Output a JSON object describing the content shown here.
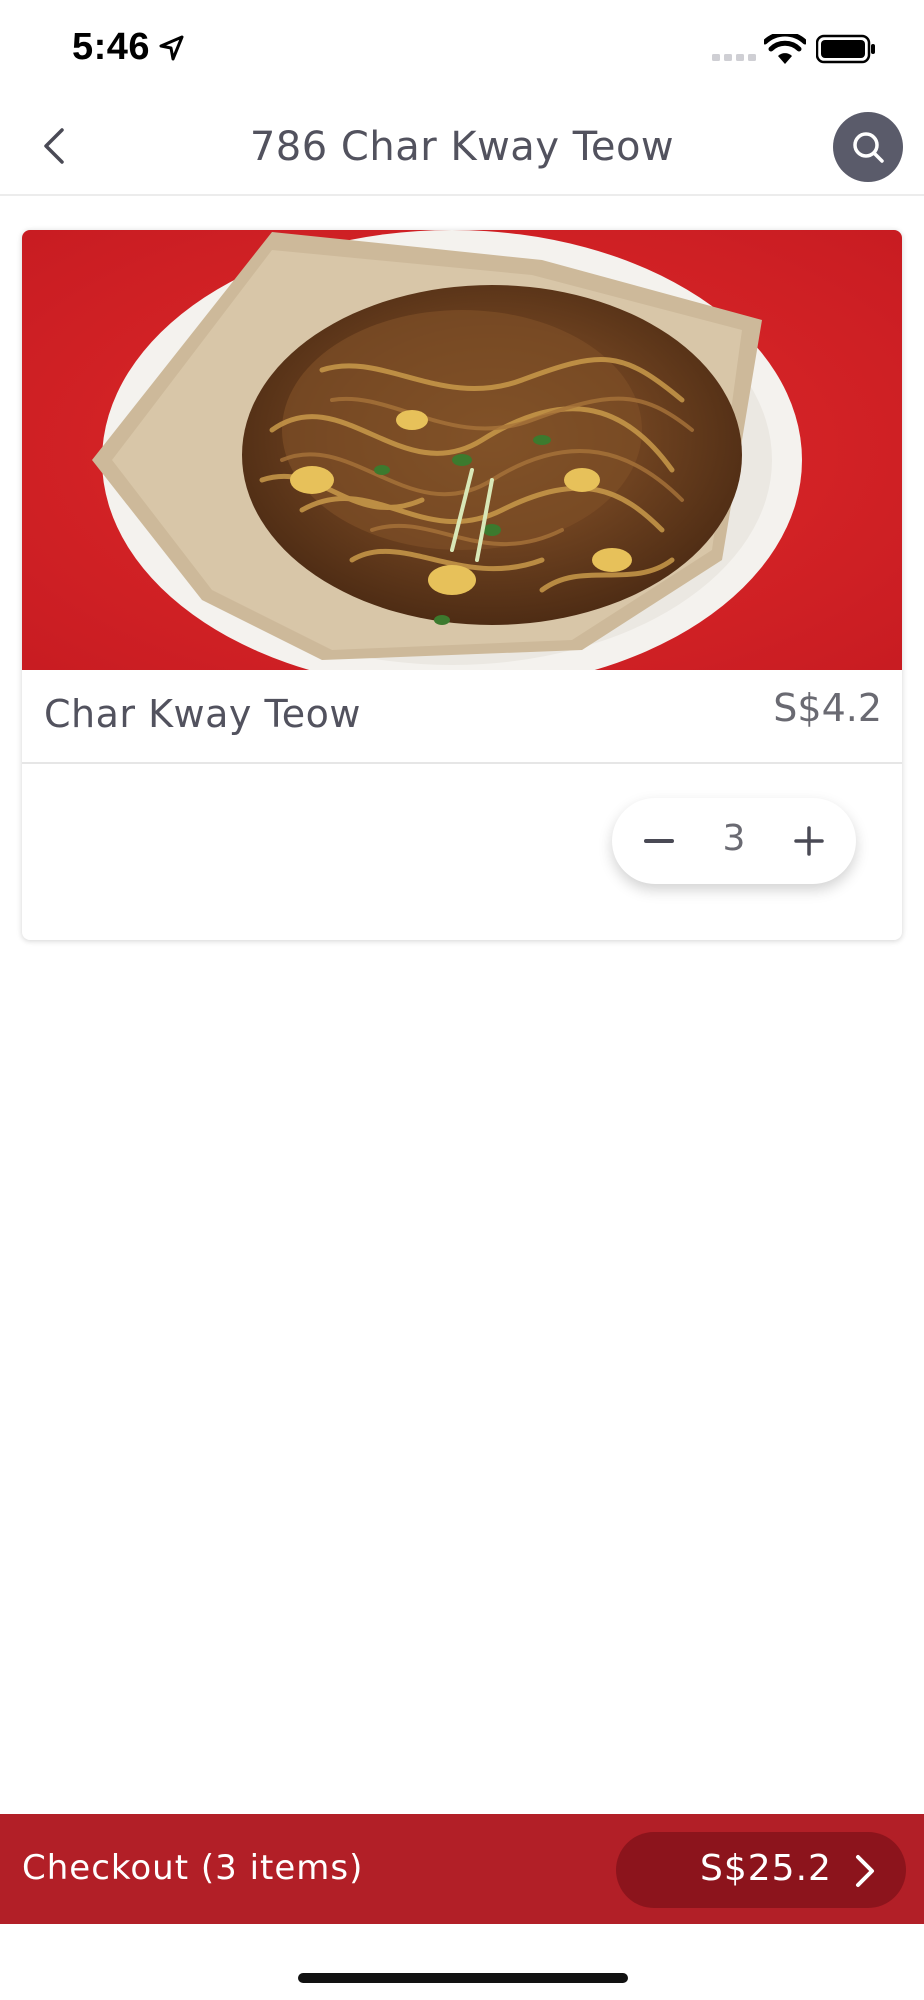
{
  "status_bar": {
    "time": "5:46"
  },
  "nav": {
    "title": "786 Char Kway Teow"
  },
  "item": {
    "name": "Char Kway Teow",
    "price": "S$4.2",
    "quantity": "3"
  },
  "checkout": {
    "label": "Checkout (3 items)",
    "total": "S$25.2"
  },
  "colors": {
    "accent": "#b21f27",
    "accent_dark": "#8c141c",
    "search_button": "#5a5b6a",
    "text": "#52525e"
  },
  "icons": {
    "back": "chevron-left-icon",
    "search": "search-icon",
    "minus": "minus-icon",
    "plus": "plus-icon",
    "checkout_arrow": "chevron-right-icon"
  }
}
